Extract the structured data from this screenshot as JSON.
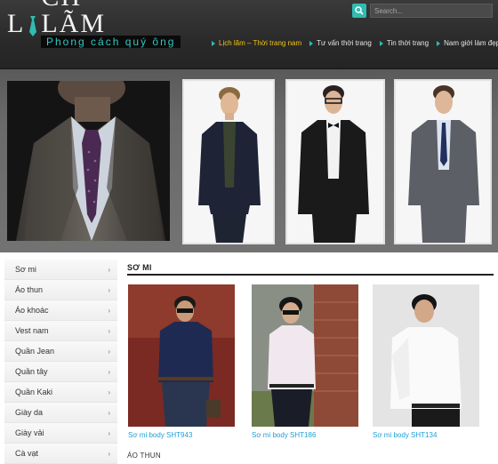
{
  "logo": {
    "word_before": "L",
    "word_after": "CH LÃM",
    "tagline": "Phong cách quý ông"
  },
  "search": {
    "placeholder": "Search..."
  },
  "nav": {
    "items": [
      {
        "label": "Lịch lãm – Thời trang nam",
        "active": true
      },
      {
        "label": "Tư vấn thời trang",
        "active": false
      },
      {
        "label": "Tin thời trang",
        "active": false
      },
      {
        "label": "Nam giới làm đẹp",
        "active": false
      }
    ]
  },
  "sidebar": {
    "items": [
      {
        "label": "Sơ mi"
      },
      {
        "label": "Áo thun"
      },
      {
        "label": "Áo khoác"
      },
      {
        "label": "Vest nam"
      },
      {
        "label": "Quần Jean"
      },
      {
        "label": "Quần tây"
      },
      {
        "label": "Quần Kaki"
      },
      {
        "label": "Giày da"
      },
      {
        "label": "Giày vải"
      },
      {
        "label": "Cà vạt"
      }
    ],
    "chevron": "›"
  },
  "section": {
    "title": "SƠ MI",
    "products": [
      {
        "name": "Sơ mi body SHT943"
      },
      {
        "name": "Sơ mi body SHT186"
      },
      {
        "name": "Sơ mi body SHT134"
      }
    ],
    "next_title": "ÁO THUN"
  },
  "colors": {
    "accent": "#2fbcb2",
    "active_nav": "#f0c419",
    "link": "#1f9fd6"
  }
}
